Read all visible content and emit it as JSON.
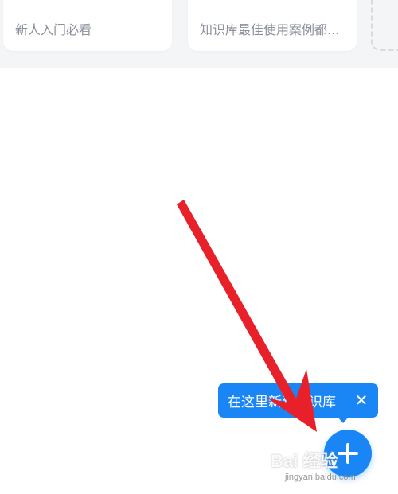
{
  "cards": [
    {
      "title": "新人入门必看"
    },
    {
      "title": "知识库最佳使用案例都..."
    }
  ],
  "tooltip": {
    "text": "在这里新建知识库",
    "close_symbol": "✕"
  },
  "fab": {
    "icon": "plus-icon"
  },
  "annotation": {
    "color": "#e8202a"
  },
  "watermark": {
    "logo": "Bai  经验",
    "url": "jingyan.baidu.com"
  },
  "colors": {
    "accent": "#1a86f5",
    "band": "#f4f5f7",
    "card_text": "#8a8f99"
  }
}
